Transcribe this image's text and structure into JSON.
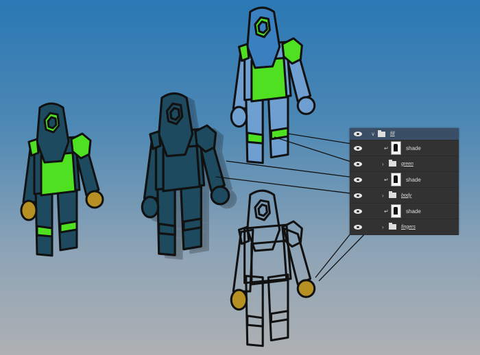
{
  "layers_panel": {
    "layers": [
      {
        "name": "fill",
        "type": "group",
        "expanded": true,
        "visible": true,
        "selected": true
      },
      {
        "name": "shade",
        "type": "clipped-layer",
        "visible": true
      },
      {
        "name": "green",
        "type": "group",
        "expanded": false,
        "visible": true
      },
      {
        "name": "shade",
        "type": "clipped-layer",
        "visible": true
      },
      {
        "name": "body",
        "type": "group",
        "expanded": false,
        "visible": true
      },
      {
        "name": "shade",
        "type": "clipped-layer",
        "visible": true
      },
      {
        "name": "fingers",
        "type": "group",
        "expanded": false,
        "visible": true
      }
    ]
  },
  "colors": {
    "body": "#1d4a5e",
    "green": "#4fe021",
    "hands": "#b79024",
    "outline": "#111111",
    "panel": "#323232"
  }
}
